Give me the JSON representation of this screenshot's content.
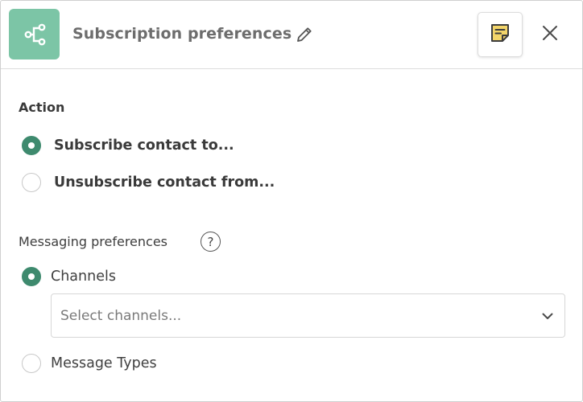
{
  "header": {
    "title": "Subscription preferences",
    "app_icon": "subscription-flow-icon",
    "edit_icon": "pencil-icon",
    "notes_icon": "sticky-note-icon",
    "close_icon": "close-icon"
  },
  "action": {
    "label": "Action",
    "options": [
      {
        "label": "Subscribe contact to...",
        "checked": true
      },
      {
        "label": "Unsubscribe contact from...",
        "checked": false
      }
    ]
  },
  "messaging": {
    "label": "Messaging preferences",
    "help_icon": "question-mark-icon",
    "options": [
      {
        "label": "Channels",
        "checked": true
      },
      {
        "label": "Message Types",
        "checked": false
      }
    ],
    "channels_select": {
      "placeholder": "Select channels...",
      "icon": "chevron-down-icon"
    }
  },
  "colors": {
    "accent": "#3e8a6e",
    "app_icon_bg": "#7cc5a6",
    "note_yellow": "#f3d56a"
  }
}
